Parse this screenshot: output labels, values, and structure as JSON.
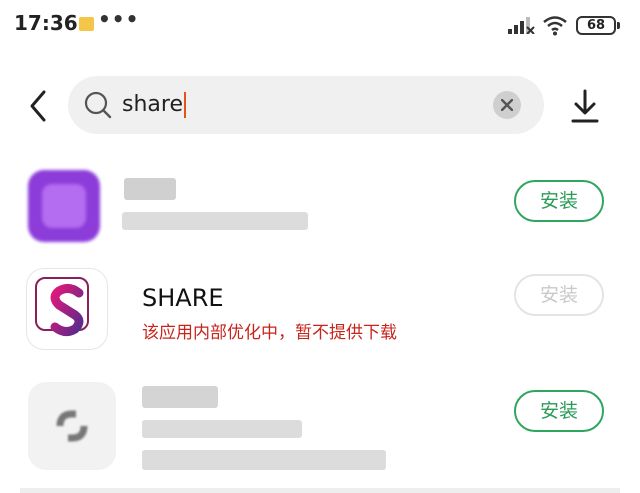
{
  "status_bar": {
    "time": "17:36",
    "dots": "•••",
    "battery": "68"
  },
  "search": {
    "query": "share",
    "icons": [
      "back-arrow-icon",
      "search-icon",
      "clear-icon",
      "download-icon"
    ]
  },
  "results": [
    {
      "title": "",
      "subtitle": "",
      "install_label": "安装",
      "install_enabled": true
    },
    {
      "title": "SHARE",
      "subtitle": "该应用内部优化中，暂不提供下载",
      "install_label": "安装",
      "install_enabled": false
    },
    {
      "title": "",
      "subtitle": "",
      "install_label": "安装",
      "install_enabled": true
    }
  ],
  "colors": {
    "install_green": "#2b9a57",
    "warning_red": "#c8241c",
    "search_bg": "#f0f0f0",
    "purple_icon": "#8c3cd9"
  }
}
